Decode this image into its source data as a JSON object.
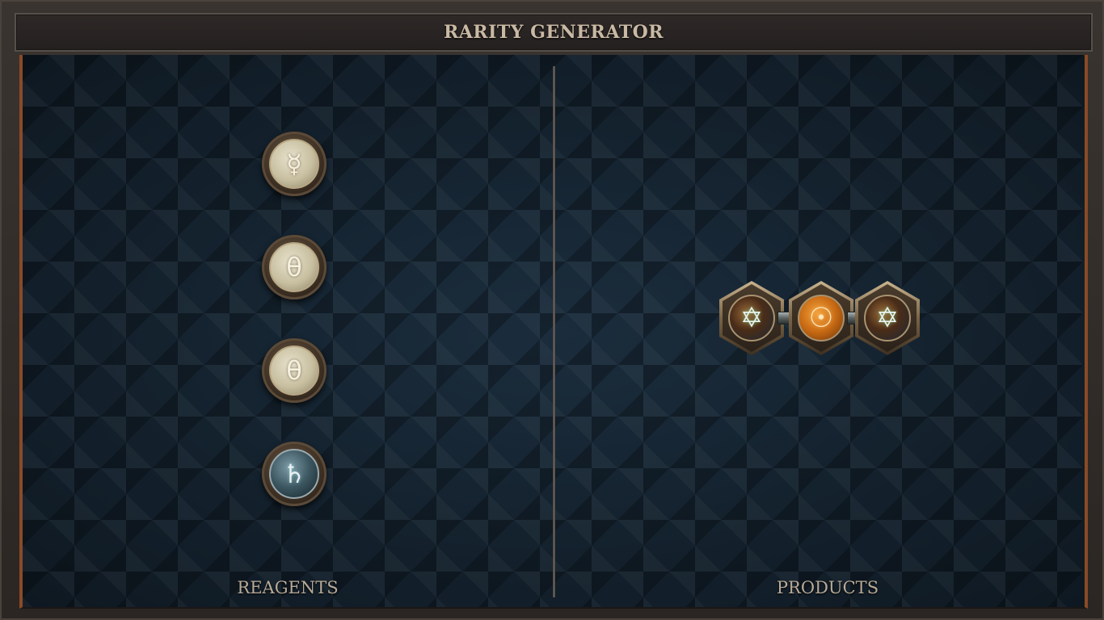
{
  "header": {
    "title": "RARITY GENERATOR"
  },
  "reagents": {
    "label": "REAGENTS",
    "items": [
      {
        "symbol": "☿",
        "icon": "mercury-symbol-icon",
        "tone": "light"
      },
      {
        "symbol": "θ",
        "icon": "theta-symbol-icon",
        "tone": "light"
      },
      {
        "symbol": "θ",
        "icon": "theta-symbol-icon",
        "tone": "light"
      },
      {
        "symbol": "♄",
        "icon": "saturn-symbol-icon",
        "tone": "dark"
      }
    ]
  },
  "products": {
    "label": "PRODUCTS",
    "chain": [
      {
        "symbol": "✡",
        "icon": "hexagram-icon"
      },
      {
        "symbol": "☉",
        "icon": "sun-symbol-icon"
      },
      {
        "symbol": "✡",
        "icon": "hexagram-icon"
      }
    ]
  },
  "colors": {
    "board": "#142230",
    "frame_accent": "#8a4a26",
    "title_text": "#c9b9a4",
    "label_text": "#b8aa98"
  }
}
